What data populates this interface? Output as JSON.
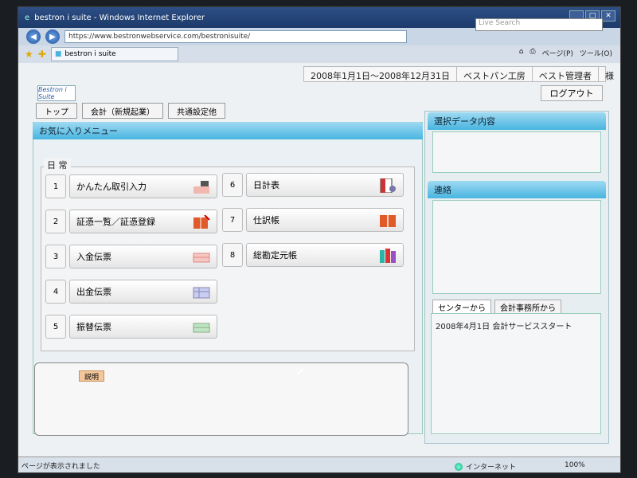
{
  "browser": {
    "title": "bestron i suite - Windows Internet Explorer",
    "url": "https://www.bestronwebservice.com/bestronisuite/",
    "tab_title": "bestron i suite",
    "search_placeholder": "Live Search",
    "tools": [
      "ページ(P)",
      "ツール(O)"
    ],
    "status_text": "ページが表示されました",
    "zone": "インターネット",
    "zoom": "100%"
  },
  "app": {
    "logo_text": "Bestron i Suite",
    "date_range": "2008年1月1日～2008年12月31日",
    "company": "ベストパン工房",
    "user": "ベスト管理者",
    "honorific": "様",
    "logout": "ログアウト",
    "nav_tabs": [
      "トップ",
      "会計（新規起業）",
      "共通設定他"
    ]
  },
  "favorites": {
    "title": "お気に入りメニュー",
    "group_label": "日 常",
    "items": [
      {
        "num": "1",
        "label": "かんたん取引入力"
      },
      {
        "num": "2",
        "label": "証憑一覧／証憑登録"
      },
      {
        "num": "3",
        "label": "入金伝票"
      },
      {
        "num": "4",
        "label": "出金伝票"
      },
      {
        "num": "5",
        "label": "振替伝票"
      },
      {
        "num": "6",
        "label": "日計表"
      },
      {
        "num": "7",
        "label": "仕訳帳"
      },
      {
        "num": "8",
        "label": "総勘定元帳"
      }
    ]
  },
  "description": {
    "label": "説明"
  },
  "right": {
    "selected_title": "選択データ内容",
    "contact_title": "連絡",
    "tab_center": "センターから",
    "tab_office": "会計事務所から",
    "message": "2008年4月1日 会計サービススタート"
  },
  "colors": {
    "panel_header": "#48b5e0",
    "title_bar": "#1d3a6a",
    "desc_label": "#f3c79b"
  }
}
